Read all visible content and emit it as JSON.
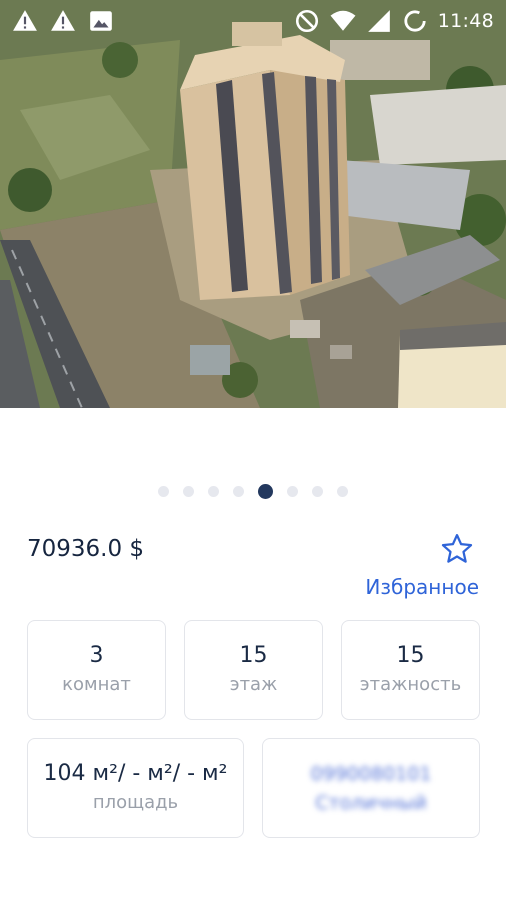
{
  "status_bar": {
    "time": "11:48",
    "left_icons": [
      "warning-icon",
      "warning-icon",
      "image-icon"
    ],
    "right_icons": [
      "do-not-disturb-icon",
      "wifi-icon",
      "cell-signal-icon",
      "sync-icon"
    ]
  },
  "carousel": {
    "count": 8,
    "active_index": 4
  },
  "listing": {
    "price": "70936.0 $",
    "favorite_label": "Избранное"
  },
  "cards": {
    "rooms": {
      "value": "3",
      "label": "комнат"
    },
    "floor": {
      "value": "15",
      "label": "этаж"
    },
    "floors": {
      "value": "15",
      "label": "этажность"
    },
    "area": {
      "value": "104 м²/ - м²/  - м²",
      "label": "площадь"
    },
    "contact": {
      "line1": "0990080101",
      "line2": "Столичный"
    }
  },
  "colors": {
    "accent": "#2f64d8",
    "dark": "#23385e",
    "card_border": "#e3e5ea",
    "muted_text": "#9aa0aa"
  }
}
